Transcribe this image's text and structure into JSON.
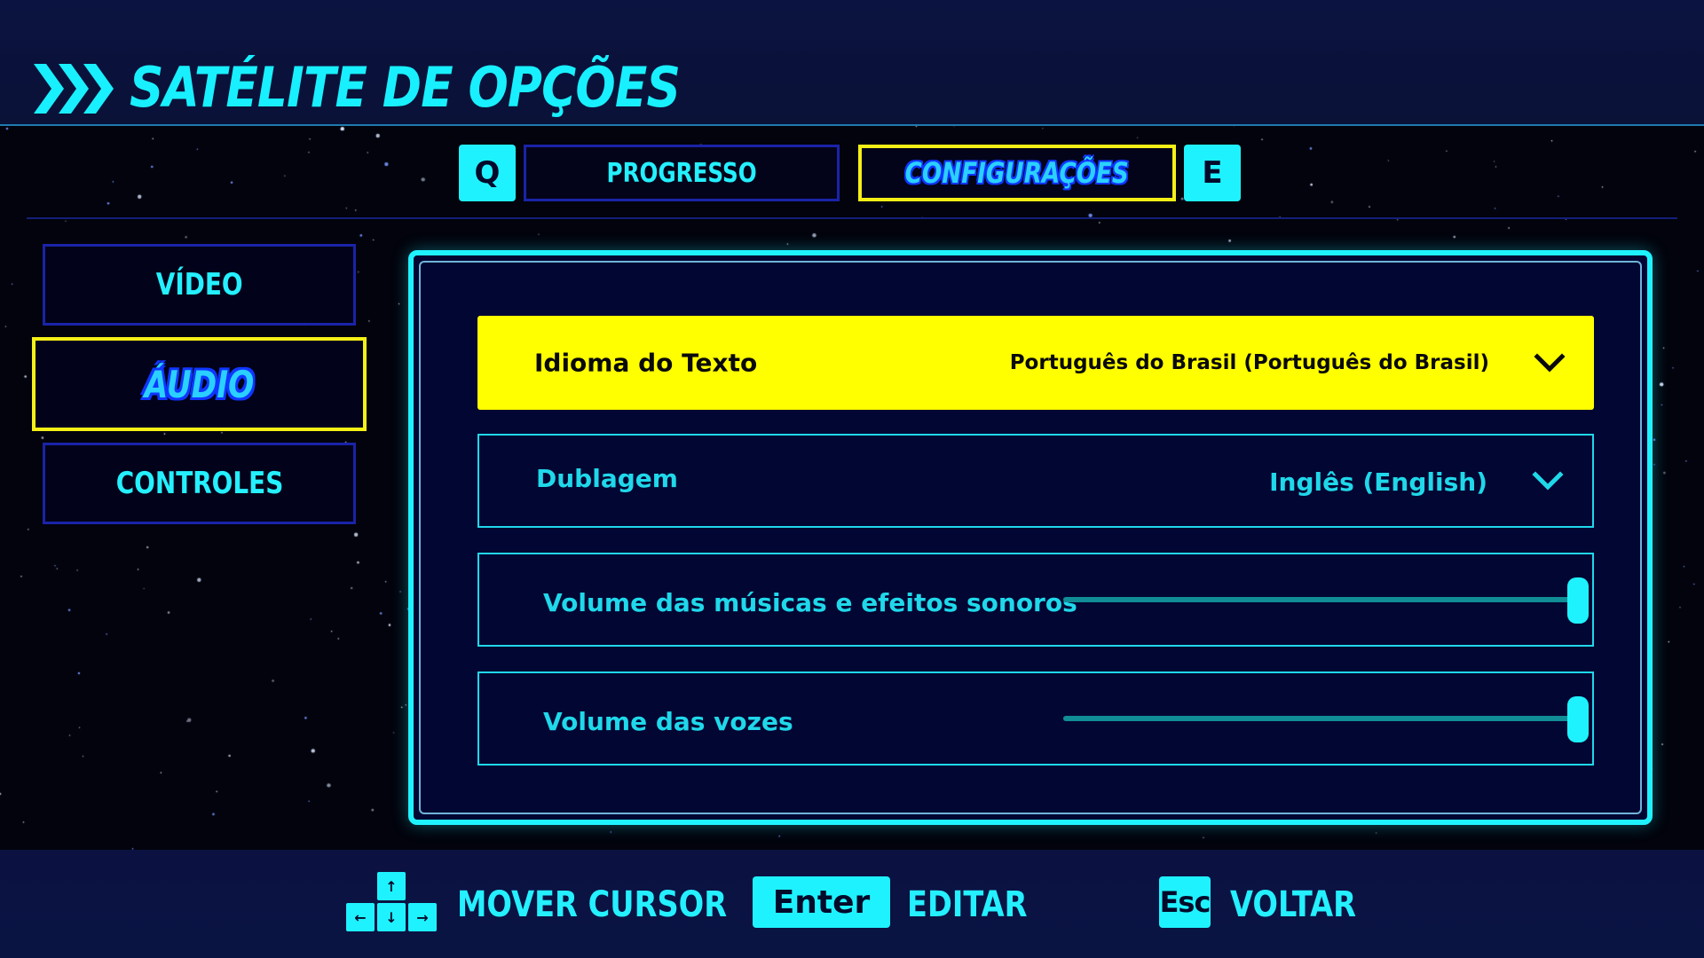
{
  "header": {
    "title": "SATÉLITE DE OPÇÕES"
  },
  "tabs": {
    "prev_key": "Q",
    "next_key": "E",
    "items": [
      {
        "label": "PROGRESSO",
        "active": false
      },
      {
        "label": "CONFIGURAÇÕES",
        "active": true
      }
    ]
  },
  "sidebar": {
    "items": [
      {
        "label": "VÍDEO",
        "active": false
      },
      {
        "label": "ÁUDIO",
        "active": true
      },
      {
        "label": "CONTROLES",
        "active": false
      }
    ]
  },
  "settings": {
    "rows": [
      {
        "label": "Idioma do Texto",
        "value": "Português do Brasil (Português do Brasil)",
        "type": "dropdown",
        "selected": true
      },
      {
        "label": "Dublagem",
        "value": "Inglês (English)",
        "type": "dropdown",
        "selected": false
      },
      {
        "label": "Volume das músicas e efeitos sonoros",
        "type": "slider",
        "level": 1.0,
        "selected": false
      },
      {
        "label": "Volume das vozes",
        "type": "slider",
        "level": 1.0,
        "selected": false
      }
    ]
  },
  "footer": {
    "move_keys": {
      "up": "↑",
      "left": "←",
      "down": "↓",
      "right": "→"
    },
    "move_label": "MOVER CURSOR",
    "edit_key": "Enter",
    "edit_label": "EDITAR",
    "back_key": "Esc",
    "back_label": "VOLTAR"
  },
  "colors": {
    "accent": "#1ff2ff",
    "highlight": "#ffff00",
    "panel_bg": "#020633",
    "tab_border": "#1a23a8",
    "page_bg": "#02030c"
  },
  "icons": {
    "title": "triple-chevron-right-icon",
    "dropdown": "chevron-down-icon"
  }
}
